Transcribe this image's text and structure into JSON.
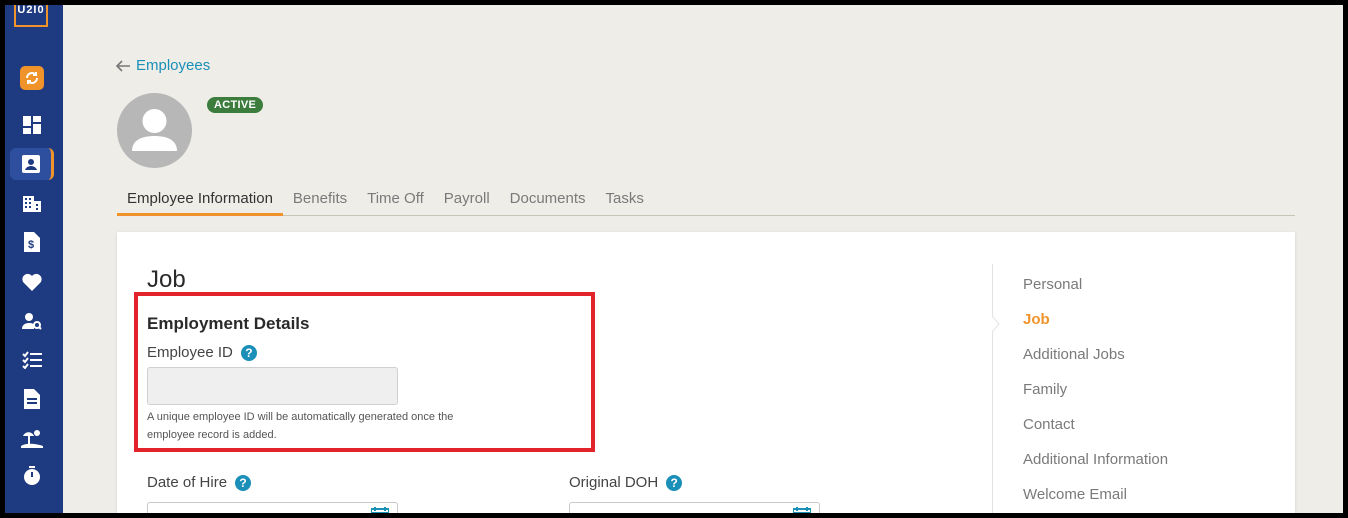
{
  "app": {
    "logo_text": "U2I0"
  },
  "header": {
    "back_label": "Employees",
    "status_badge": "ACTIVE"
  },
  "tabs": [
    {
      "label": "Employee Information"
    },
    {
      "label": "Benefits"
    },
    {
      "label": "Time Off"
    },
    {
      "label": "Payroll"
    },
    {
      "label": "Documents"
    },
    {
      "label": "Tasks"
    }
  ],
  "card": {
    "title": "Job",
    "section_title": "Employment Details",
    "employee_id_label": "Employee ID",
    "employee_id_value": "",
    "employee_id_help": "A unique employee ID will be automatically generated once the employee record is added.",
    "date_of_hire_label": "Date of Hire",
    "original_doh_label": "Original DOH"
  },
  "side_nav": [
    {
      "label": "Personal"
    },
    {
      "label": "Job"
    },
    {
      "label": "Additional Jobs"
    },
    {
      "label": "Family"
    },
    {
      "label": "Contact"
    },
    {
      "label": "Additional Information"
    },
    {
      "label": "Welcome Email"
    }
  ],
  "colors": {
    "sidebar": "#1e3a80",
    "accent": "#f0932b",
    "link": "#1a8fb7",
    "badge": "#3c7d3e",
    "highlight": "#e3232b"
  }
}
